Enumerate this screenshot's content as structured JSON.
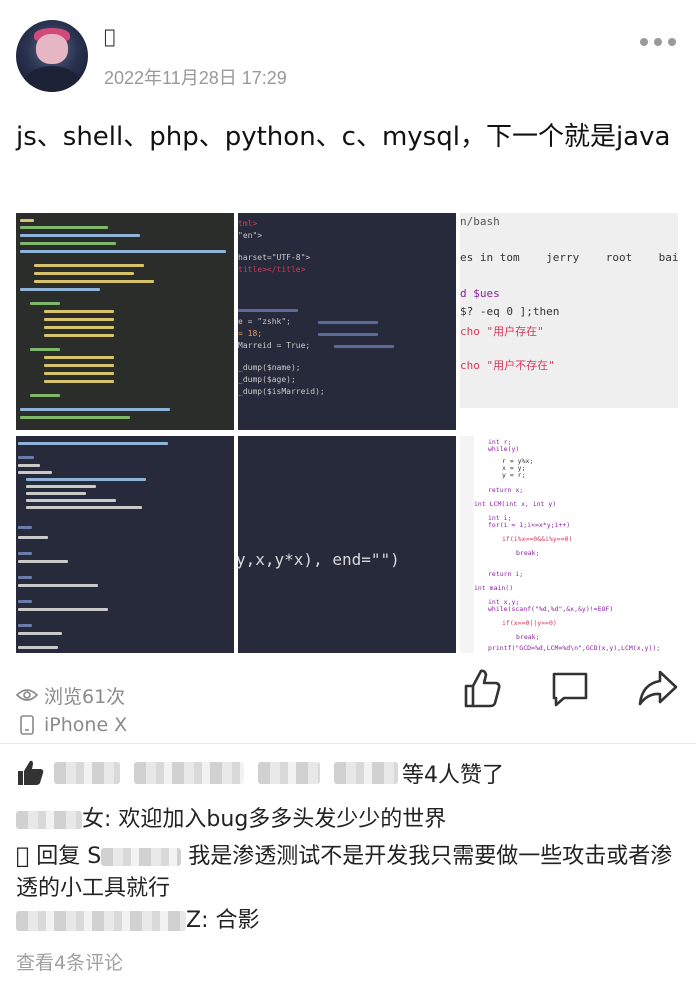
{
  "post": {
    "username": "􏰀",
    "timestamp": "2022年11月28日 17:29",
    "text": "js、shell、php、python、c、mysql，下一个就是java"
  },
  "images": {
    "img2_snippets": [
      "tml>",
      "\"en\">",
      "harset=\"UTF-8\">",
      "title></title>",
      "e = \"zshk\";",
      "= 18;",
      "Marreid = True;",
      "_dump($name);",
      "_dump($age);",
      "_dump($isMarreid);"
    ],
    "img3_lines": [
      "n/bash",
      "es in tom    jerry    root    baidu",
      "d $ues",
      "$? -eq 0 ];then",
      "cho \"用户存在\"",
      "cho \"用户不存在\""
    ],
    "img5_code": "y,x,y*x), end=\"\")",
    "img6_lines": [
      "int r;",
      "while(y)",
      "r = y%x;",
      "x = y;",
      "y = r;",
      "return x;",
      "int LCM(int x, int y)",
      "int i;",
      "for(i = 1;i<=x*y;i++)",
      "if(i%x==0&&i%y==0)",
      "break;",
      "return i;",
      "int main()",
      "int x,y;",
      "while(scanf(\"%d,%d\",&x,&y)!=EOF)",
      "if(x==0||y==0)",
      "break;",
      "printf(\"GCD=%d,LCM=%d\\n\",GCD(x,y),LCM(x,y));"
    ]
  },
  "stats": {
    "views": "浏览61次",
    "device": "iPhone X"
  },
  "likes": {
    "suffix": "等4人赞了"
  },
  "comments": [
    {
      "author_tail": "女:",
      "text": "欢迎加入bug多多头发少少的世界"
    },
    {
      "author": "􏰀",
      "reply_label": "回复",
      "reply_to": "S",
      "text": "我是渗透测试不是开发我只需要做一些攻击或者渗透的小工具就行"
    },
    {
      "author_tail": "Z:",
      "text": "合影"
    }
  ],
  "view_all_comments": "查看4条评论",
  "colors": {
    "meta_gray": "#999999",
    "code_bg_dark": "#262a3a",
    "code_bg_green": "#2b2d2b",
    "string_red": "#d6375a",
    "keyword_purple": "#8a1fa0"
  },
  "icons": [
    "more-icon",
    "eye-icon",
    "phone-icon",
    "thumbs-up-icon",
    "comment-icon",
    "share-icon",
    "like-filled-icon"
  ]
}
